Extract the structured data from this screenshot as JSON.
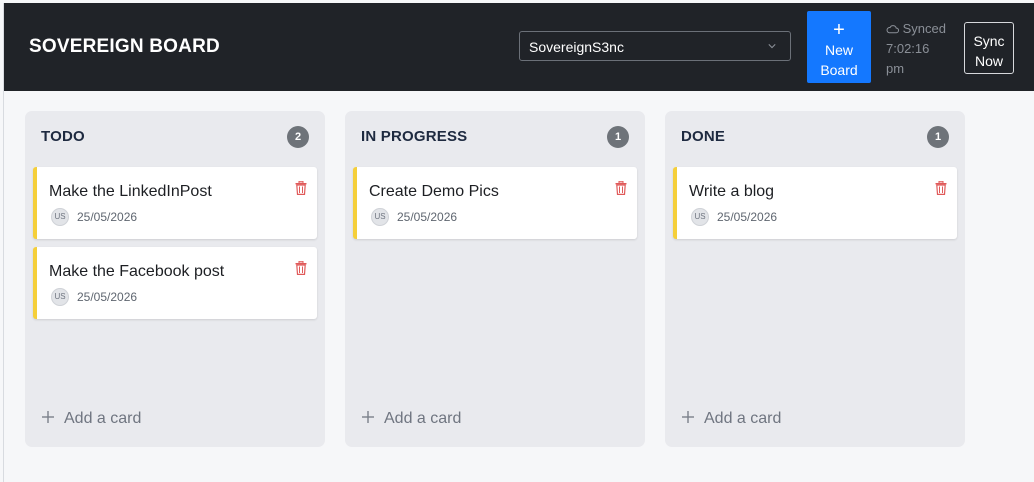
{
  "header": {
    "brand": "SOVEREIGN BOARD",
    "board_select_value": "SovereignS3nc",
    "new_board_line1": "New",
    "new_board_line2": "Board",
    "sync_status_word": "Synced",
    "sync_time": "7:02:16",
    "sync_ampm": "pm",
    "sync_now_line1": "Sync",
    "sync_now_line2": "Now"
  },
  "columns": [
    {
      "title": "TODO",
      "count": "2",
      "cards": [
        {
          "title": "Make the LinkedInPost",
          "avatar": "US",
          "date": "25/05/2026"
        },
        {
          "title": "Make the Facebook post",
          "avatar": "US",
          "date": "25/05/2026"
        }
      ],
      "add_label": "Add a card"
    },
    {
      "title": "IN PROGRESS",
      "count": "1",
      "cards": [
        {
          "title": "Create Demo Pics",
          "avatar": "US",
          "date": "25/05/2026"
        }
      ],
      "add_label": "Add a card"
    },
    {
      "title": "DONE",
      "count": "1",
      "cards": [
        {
          "title": "Write a blog",
          "avatar": "US",
          "date": "25/05/2026"
        }
      ],
      "add_label": "Add a card"
    }
  ],
  "icons": {
    "select_chevron": "chevron-down-icon",
    "new_board": "plus-icon",
    "sync_status": "cloud-check-icon",
    "card_delete": "trash-icon",
    "add_card": "plus-icon"
  },
  "colors": {
    "header_bg": "#202328",
    "accent_button": "#1478ff",
    "card_stripe": "#f5cf3a",
    "delete_icon": "#e05a5a",
    "count_badge": "#6e7379"
  }
}
